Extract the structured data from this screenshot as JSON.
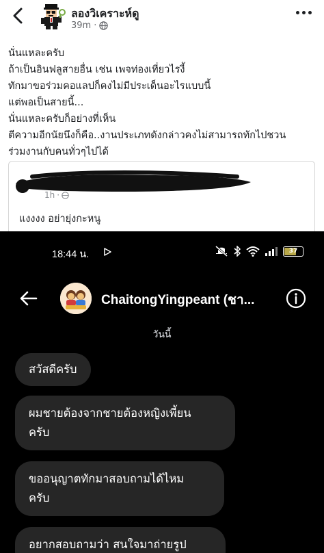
{
  "post": {
    "author": "ลองวิเคราะห์ดู",
    "time": "39m",
    "separator": "·",
    "lines": [
      "นั่นแหละครับ",
      "ถ้าเป็นอินฟลูสายอื่น เช่น เพจท่องเที่ยวไรงี้",
      "ทักมาขอร่วมคอแลปก็คงไม่มีประเด็นอะไรแบบนี้",
      "แต่พอเป็นสายนี้...",
      "นั่นแหละครับก็อย่างที่เห็น",
      "ตีความอีกนัยนึงก็คือ..งานประเภทดังกล่าวคงไม่สามารถทักไปชวน",
      "ร่วมงานกับคนทั่วๆไปได้"
    ],
    "shared": {
      "meta_time": "1h",
      "text": "แงงงง อย่ายุ่งกะหนู"
    }
  },
  "dm": {
    "status": {
      "time": "18:44 น.",
      "battery": "37"
    },
    "header": {
      "name": "ChaitongYingpeant (ชา..."
    },
    "date_label": "วันนี้",
    "messages": [
      {
        "lines": [
          "สวัสดีครับ"
        ]
      },
      {
        "lines": [
          "ผมชายต้องจากชายต้องหญิงเพี้ยน",
          "ครับ"
        ]
      },
      {
        "lines": [
          "ขออนุญาตทักมาสอบถามได้ไหม",
          "ครับ"
        ]
      },
      {
        "lines": [
          "อยากสอบถามว่า สนใจมาถ่ายรูป"
        ]
      }
    ]
  },
  "colors": {
    "fb_text": "#1c1e21",
    "fb_meta": "#65676b",
    "dm_bg": "#000000",
    "dm_bubble": "#262626"
  },
  "icons": [
    "back-chevron-icon",
    "globe-icon",
    "more-options-icon",
    "play-icon",
    "mute-icon",
    "bluetooth-icon",
    "wifi-icon",
    "signal-icon",
    "battery-icon",
    "back-arrow-icon",
    "info-icon"
  ]
}
